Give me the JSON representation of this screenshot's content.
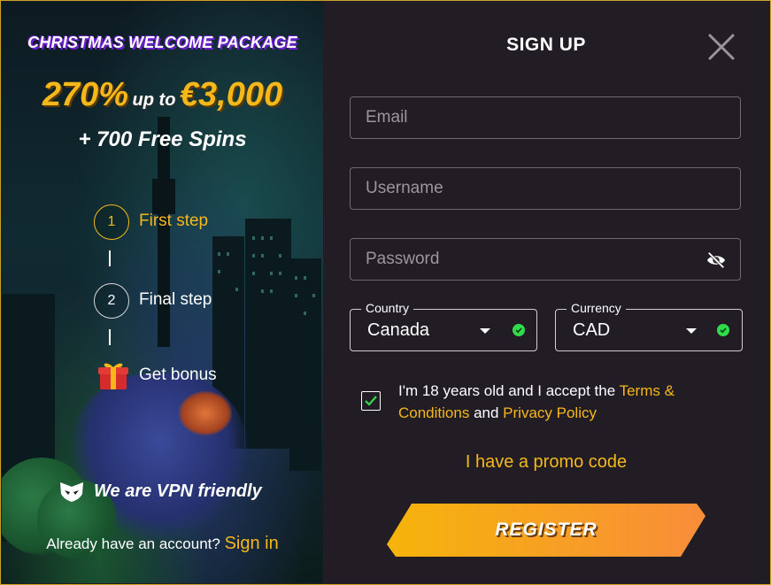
{
  "promo": {
    "title": "CHRISTMAS WELCOME PACKAGE",
    "offer_percent": "270%",
    "offer_upto": "up to",
    "offer_amount": "€3,000",
    "spins": "+ 700 Free Spins",
    "steps": [
      {
        "number": "1",
        "label": "First step",
        "active": true
      },
      {
        "number": "2",
        "label": "Final step",
        "active": false
      }
    ],
    "bonus_label": "Get bonus",
    "bonus_icon": "gift-icon",
    "vpn_text": "We are VPN friendly",
    "vpn_icon": "mask-icon",
    "already_text": "Already have an account?",
    "signin_label": "Sign in"
  },
  "form": {
    "title": "SIGN UP",
    "close_icon": "close-icon",
    "email_placeholder": "Email",
    "username_placeholder": "Username",
    "password_placeholder": "Password",
    "password_toggle_icon": "eye-slash-icon",
    "country": {
      "label": "Country",
      "value": "Canada",
      "valid": true
    },
    "currency": {
      "label": "Currency",
      "value": "CAD",
      "valid": true
    },
    "terms_checked": true,
    "terms_text_1": "I'm 18 years old and I accept the",
    "terms_link": "Terms & Conditions",
    "terms_and": "and",
    "privacy_link": "Privacy Policy",
    "promo_code_label": "I have a promo code",
    "register_label": "REGISTER"
  },
  "colors": {
    "accent": "#f5b81b",
    "background": "#221d24",
    "border": "#c9a227",
    "valid": "#2fdc4a",
    "title_shadow": "#6b1fd1"
  }
}
